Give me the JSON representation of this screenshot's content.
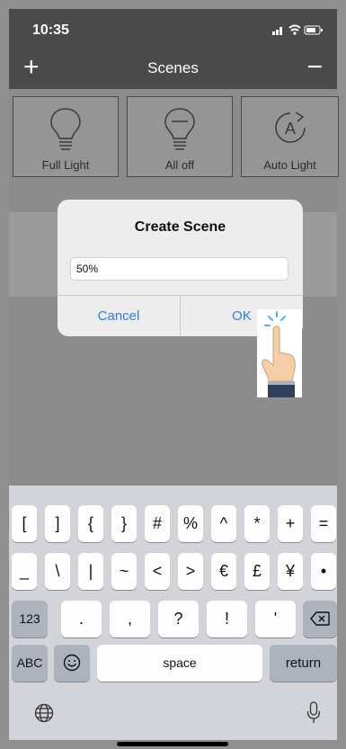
{
  "status_bar": {
    "time": "10:35"
  },
  "nav_bar": {
    "title": "Scenes",
    "add_label": "+",
    "remove_label": "−"
  },
  "scenes": [
    {
      "label": "Full Light",
      "icon": "lightbulb-icon"
    },
    {
      "label": "All off",
      "icon": "lightbulb-off-icon"
    },
    {
      "label": "Auto Light",
      "icon": "auto-light-icon"
    }
  ],
  "dialog": {
    "title": "Create Scene",
    "input_value": "50%",
    "cancel_label": "Cancel",
    "ok_label": "OK"
  },
  "keyboard": {
    "row1": [
      "[",
      "]",
      "{",
      "}",
      "#",
      "%",
      "^",
      "*",
      "+",
      "="
    ],
    "row2": [
      "_",
      "\\",
      "|",
      "~",
      "<",
      ">",
      "€",
      "£",
      "¥",
      "•"
    ],
    "row3": [
      ".",
      ",",
      "?",
      "!",
      "'"
    ],
    "key_123": "123",
    "key_abc": "ABC",
    "key_space": "space",
    "key_return": "return"
  },
  "colors": {
    "accent": "#2f7cf6",
    "header": "#4a4a4a"
  }
}
